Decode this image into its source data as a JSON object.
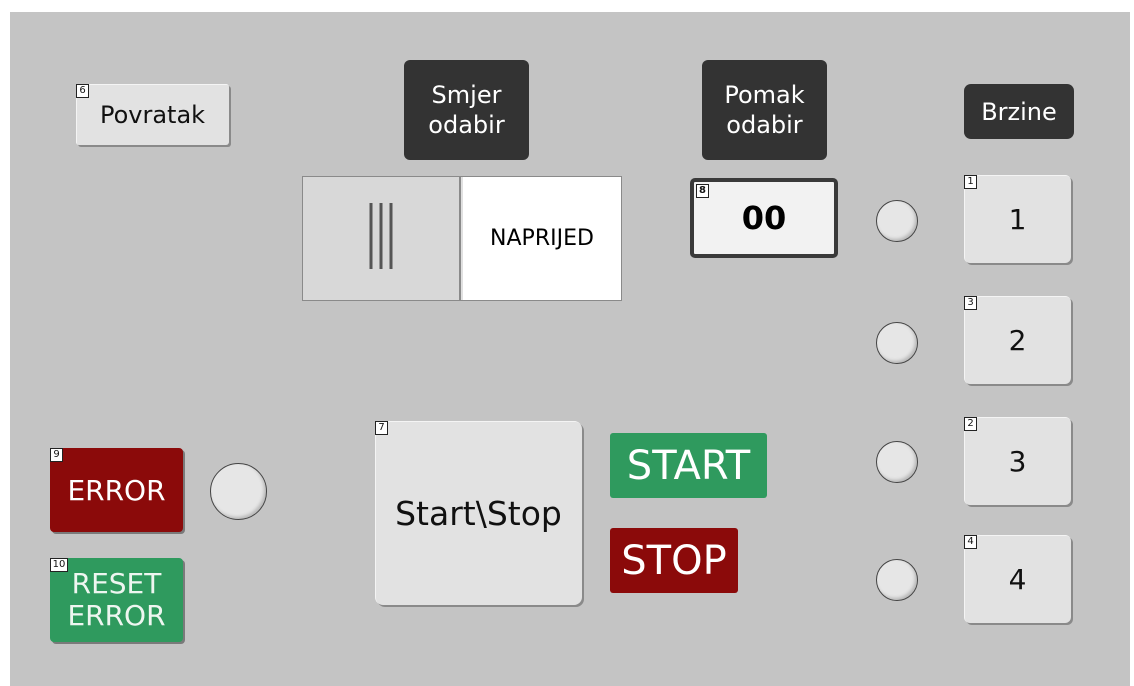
{
  "buttons": {
    "povratak": {
      "key": "6",
      "label": "Povratak"
    },
    "direction_toggle": {
      "key": "5",
      "value": "NAPRIJED"
    },
    "offset_display": {
      "key": "8",
      "value": "00"
    },
    "start_stop": {
      "key": "7",
      "label": "Start\\Stop"
    },
    "error": {
      "key": "9",
      "label": "ERROR"
    },
    "reset_error": {
      "key": "10",
      "label_line1": "RESET",
      "label_line2": "ERROR"
    }
  },
  "labels": {
    "smjer": {
      "line1": "Smjer",
      "line2": "odabir"
    },
    "pomak": {
      "line1": "Pomak",
      "line2": "odabir"
    },
    "brzine": "Brzine"
  },
  "speeds": [
    {
      "key": "1",
      "label": "1"
    },
    {
      "key": "3",
      "label": "2"
    },
    {
      "key": "2",
      "label": "3"
    },
    {
      "key": "4",
      "label": "4"
    }
  ],
  "status": {
    "start": "START",
    "stop": "STOP"
  },
  "colors": {
    "panel": "#c4c4c4",
    "dark_label": "#333333",
    "error_red": "#8b0a0a",
    "reset_green": "#2f9a5e",
    "start_green": "#2f9a5e",
    "stop_red": "#8b0a0a"
  }
}
